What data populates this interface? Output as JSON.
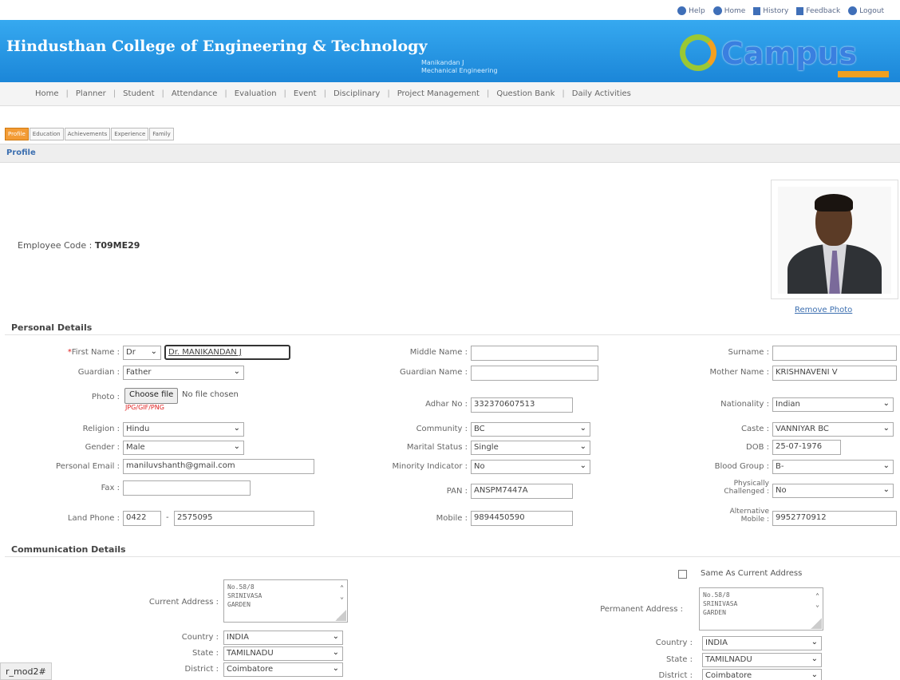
{
  "toplinks": {
    "help": "Help",
    "home": "Home",
    "history": "History",
    "feedback": "Feedback",
    "logout": "Logout"
  },
  "header": {
    "college": "Hindusthan College of Engineering & Technology",
    "user_name": "Manikandan J",
    "user_dept": "Mechanical Engineering",
    "logo_text": "Campus",
    "accent": "#1b86d8"
  },
  "menu": [
    "Home",
    "Planner",
    "Student",
    "Attendance",
    "Evaluation",
    "Event",
    "Disciplinary",
    "Project Management",
    "Question Bank",
    "Daily Activities"
  ],
  "subtabs": [
    "Profile",
    "Education",
    "Achievements",
    "Experience",
    "Family"
  ],
  "profile_title": "Profile",
  "employee": {
    "label": "Employee Code :",
    "code": "T09ME29"
  },
  "photo": {
    "remove_label": "Remove Photo"
  },
  "personal": {
    "title": "Personal Details",
    "first_name_label": "First Name :",
    "title_select": "Dr",
    "first_name": "Dr. MANIKANDAN J",
    "middle_name_label": "Middle Name :",
    "middle_name": "",
    "surname_label": "Surname :",
    "surname": "",
    "guardian_label": "Guardian :",
    "guardian": "Father",
    "guardian_name_label": "Guardian Name :",
    "guardian_name": "",
    "mother_name_label": "Mother Name :",
    "mother_name": "KRISHNAVENI V",
    "photo_label": "Photo :",
    "choose_file": "Choose file",
    "no_file": "No file chosen",
    "photo_hint": "JPG/GIF/PNG",
    "adhar_label": "Adhar No :",
    "adhar": "332370607513",
    "nationality_label": "Nationality :",
    "nationality": "Indian",
    "religion_label": "Religion :",
    "religion": "Hindu",
    "community_label": "Community :",
    "community": "BC",
    "caste_label": "Caste :",
    "caste": "VANNIYAR BC",
    "gender_label": "Gender :",
    "gender": "Male",
    "marital_label": "Marital Status :",
    "marital": "Single",
    "dob_label": "DOB :",
    "dob": "25-07-1976",
    "email_label": "Personal Email :",
    "email": "maniluvshanth@gmail.com",
    "minority_label": "Minority Indicator :",
    "minority": "No",
    "blood_label": "Blood Group :",
    "blood": "B-",
    "fax_label": "Fax :",
    "fax": "",
    "pan_label": "PAN :",
    "pan": "ANSPM7447A",
    "physically_label_1": "Physically",
    "physically_label_2": "Challenged :",
    "physically": "No",
    "land_label": "Land Phone :",
    "land_code": "0422",
    "land_number": "2575095",
    "mobile_label": "Mobile :",
    "mobile": "9894450590",
    "alt_mobile_label_1": "Alternative",
    "alt_mobile_label_2": "Mobile :",
    "alt_mobile": "9952770912"
  },
  "communication": {
    "title": "Communication Details",
    "same_as": "Same As Current Address",
    "current_label": "Current Address :",
    "current_lines": [
      "No.58/8",
      "SRINIVASA",
      "GARDEN"
    ],
    "permanent_label": "Permanent Address :",
    "permanent_lines": [
      "No.58/8",
      "SRINIVASA",
      "GARDEN"
    ],
    "country_label": "Country :",
    "country": "INDIA",
    "state_label": "State :",
    "state": "TAMILNADU",
    "district_label": "District :",
    "district": "Coimbatore"
  },
  "footer_text": "r_mod2#"
}
